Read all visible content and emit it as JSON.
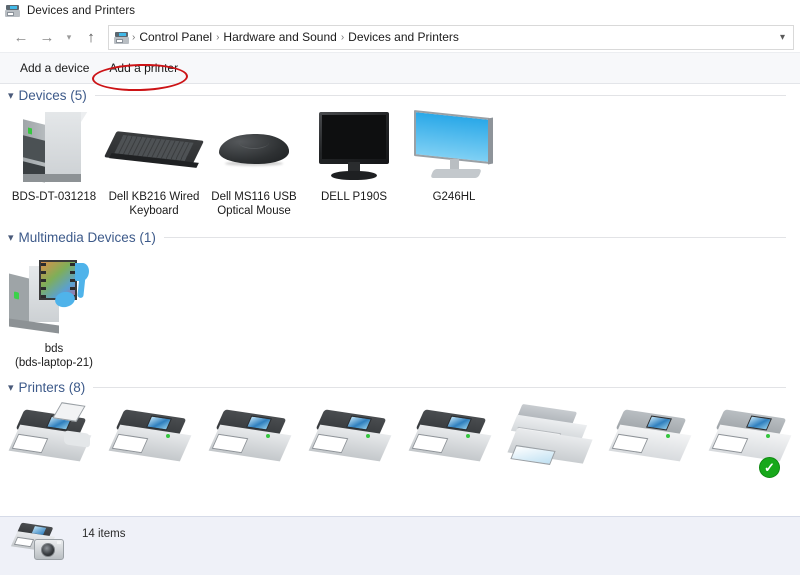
{
  "window": {
    "title": "Devices and Printers",
    "title_icon": "devices-printers-icon"
  },
  "navigation": {
    "back_icon": "back-arrow-icon",
    "forward_icon": "forward-arrow-icon",
    "recent_icon": "chevron-down-icon",
    "up_icon": "up-arrow-icon",
    "breadcrumb_icon": "devices-printers-icon",
    "breadcrumb": [
      "Control Panel",
      "Hardware and Sound",
      "Devices and Printers"
    ],
    "separator": "›",
    "dropdown_icon": "chevron-down-icon"
  },
  "toolbar": {
    "add_device_label": "Add a device",
    "add_printer_label": "Add a printer"
  },
  "annotation": {
    "shape": "ellipse",
    "color": "#cc1316",
    "target": "Add a printer"
  },
  "sections": [
    {
      "id": "devices",
      "title": "Devices (5)",
      "caret_icon": "chevron-down-icon",
      "items": [
        {
          "name": "BDS-DT-031218",
          "icon": "desktop-tower-icon"
        },
        {
          "name": "Dell KB216 Wired Keyboard",
          "icon": "keyboard-icon"
        },
        {
          "name": "Dell MS116 USB Optical Mouse",
          "icon": "mouse-icon"
        },
        {
          "name": "DELL P190S",
          "icon": "monitor-icon"
        },
        {
          "name": "G246HL",
          "icon": "monitor-icon"
        }
      ]
    },
    {
      "id": "multimedia",
      "title": "Multimedia Devices (1)",
      "caret_icon": "chevron-down-icon",
      "items": [
        {
          "name": "bds\n(bds-laptop-21)",
          "icon": "multimedia-device-icon"
        }
      ]
    },
    {
      "id": "printers",
      "title": "Printers (8)",
      "caret_icon": "chevron-down-icon",
      "items": [
        {
          "name": "",
          "icon": "fax-printer-icon",
          "default": false
        },
        {
          "name": "",
          "icon": "laser-printer-icon",
          "default": false
        },
        {
          "name": "",
          "icon": "laser-printer-icon",
          "default": false
        },
        {
          "name": "",
          "icon": "laser-printer-icon",
          "default": false
        },
        {
          "name": "",
          "icon": "laser-printer-icon",
          "default": false
        },
        {
          "name": "",
          "icon": "multifunction-printer-icon",
          "default": false
        },
        {
          "name": "",
          "icon": "laser-printer-icon",
          "default": false
        },
        {
          "name": "",
          "icon": "laser-printer-icon",
          "default": true,
          "badge": "✓"
        }
      ]
    }
  ],
  "status": {
    "items_count_label": "14 items",
    "icon": "printer-camera-icon"
  },
  "colors": {
    "section_title": "#3d5a8a",
    "annotation_red": "#cc1316",
    "default_badge_green": "#17a81a",
    "statusbar_bg": "#eff1f8",
    "toolbar_bg": "#f7f8fa"
  }
}
